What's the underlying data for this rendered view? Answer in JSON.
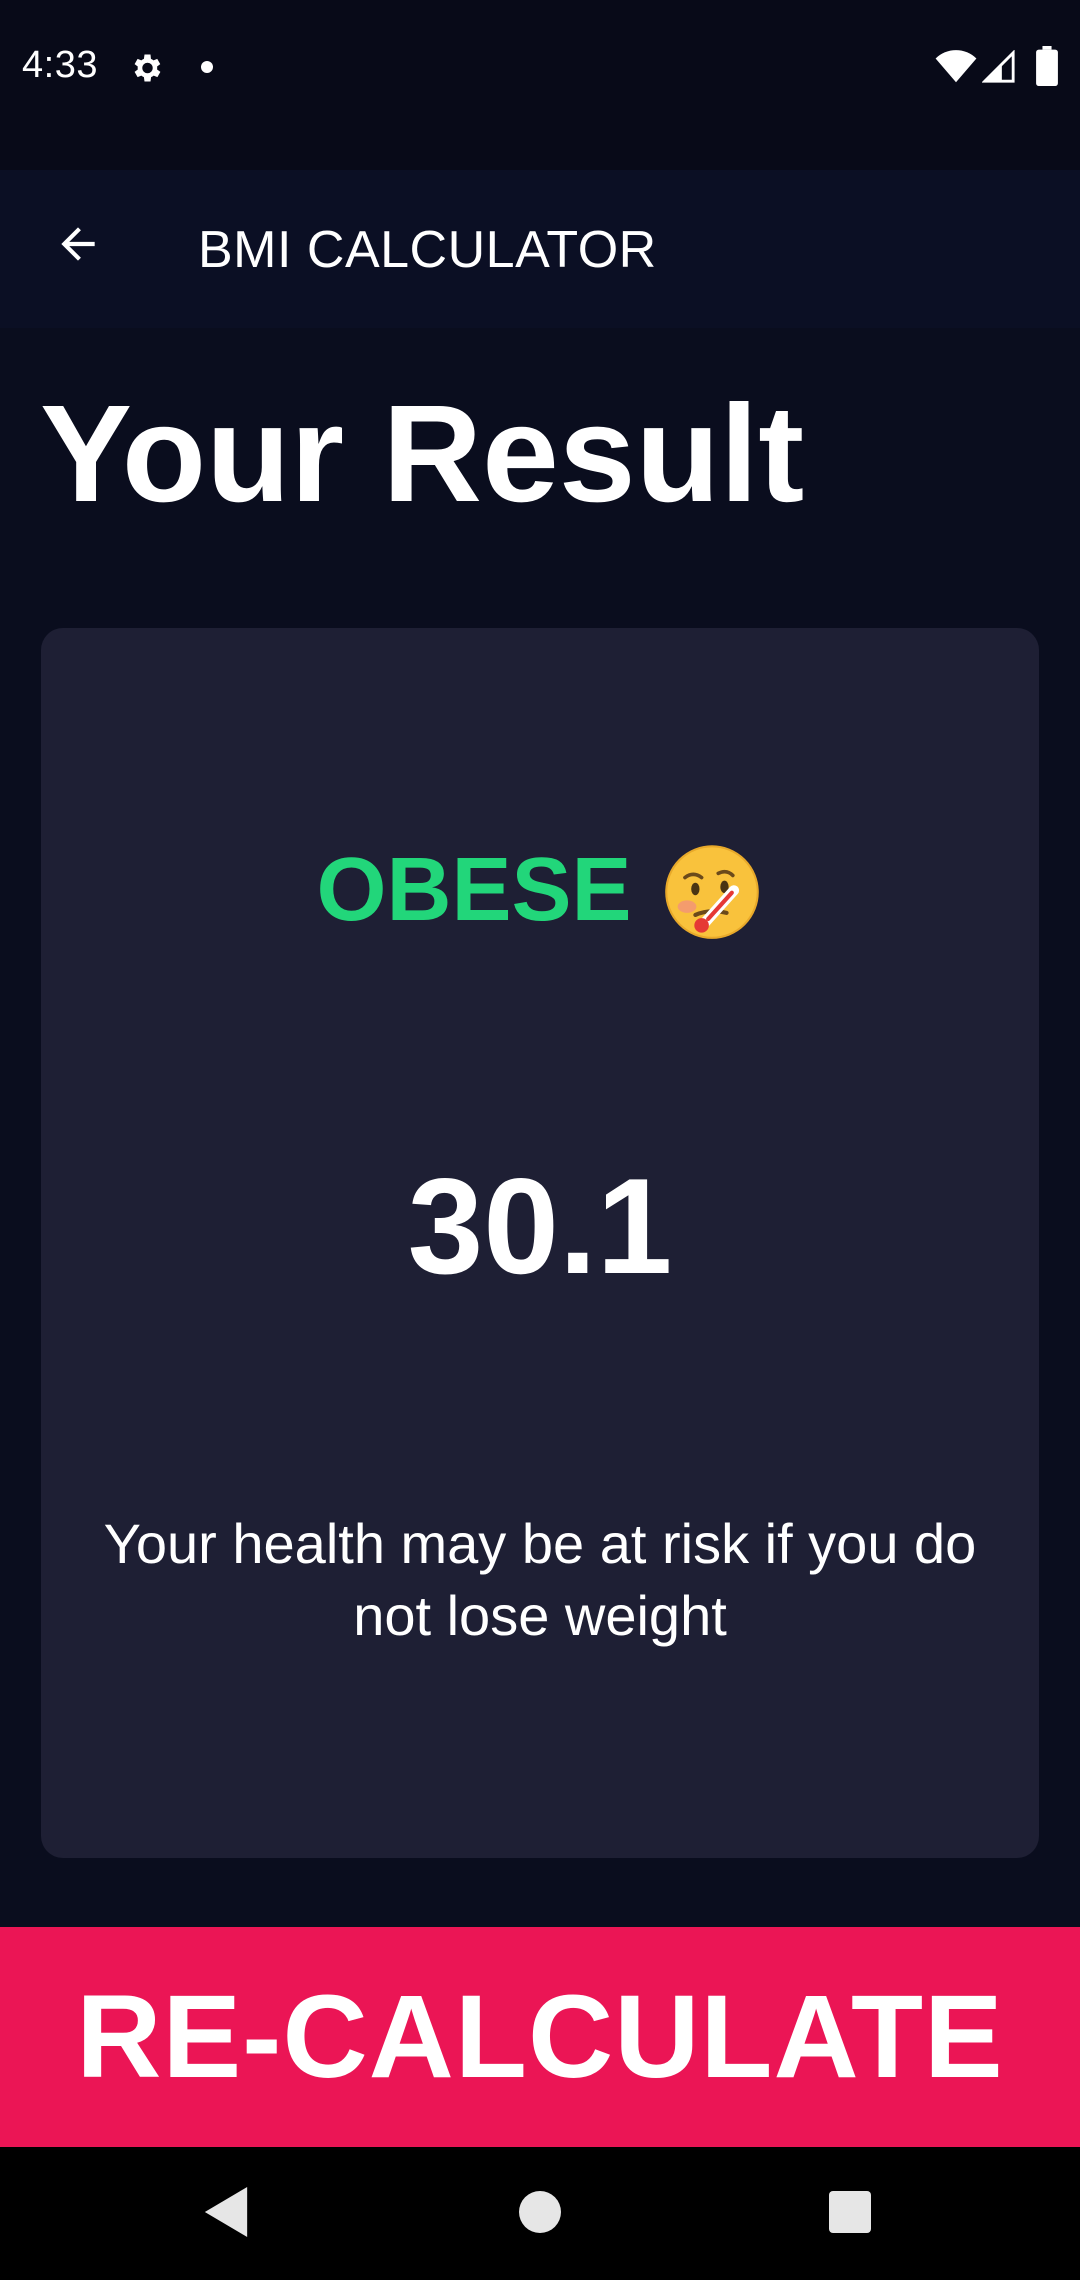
{
  "status_bar": {
    "time": "4:33",
    "icons": [
      "gear-icon",
      "notification-dot",
      "wifi-icon",
      "cell-signal-icon",
      "battery-icon"
    ]
  },
  "app_bar": {
    "back_icon": "arrow-left-icon",
    "title": "BMI CALCULATOR"
  },
  "page": {
    "title": "Your Result"
  },
  "result": {
    "status": "OBESE",
    "emoji": "face-with-thermometer",
    "bmi_value": "30.1",
    "message": "Your health may be at risk if you do not lose weight"
  },
  "action": {
    "recalculate_label": "RE-CALCULATE"
  },
  "colors": {
    "background": "#0a0d1e",
    "card": "#1e1f34",
    "status_green": "#22d67a",
    "button_pink": "#eb1555"
  },
  "nav_bar": {
    "icons": [
      "nav-back-icon",
      "nav-home-icon",
      "nav-recents-icon"
    ]
  }
}
